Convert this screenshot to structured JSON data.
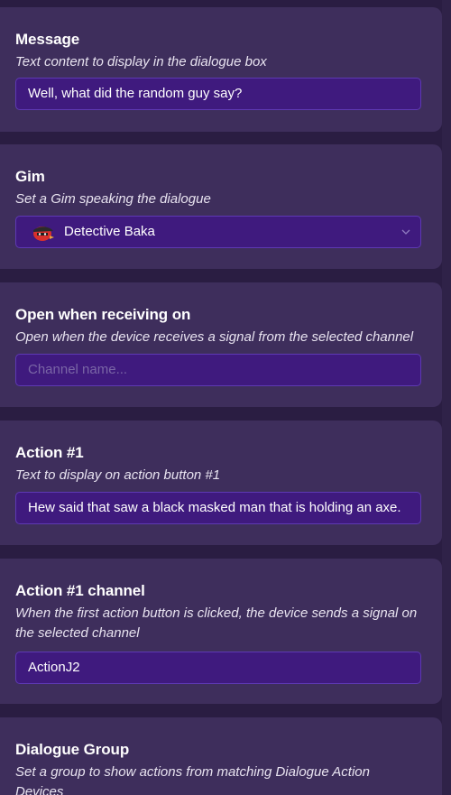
{
  "message": {
    "title": "Message",
    "description": "Text content to display in the dialogue box",
    "value": "Well, what did the random guy say?"
  },
  "gim": {
    "title": "Gim",
    "description": "Set a Gim speaking the dialogue",
    "value": "Detective Baka",
    "avatar_icon": "gim-avatar-icon"
  },
  "open_on": {
    "title": "Open when receiving on",
    "description": "Open when the device receives a signal from the selected channel",
    "placeholder": "Channel name..."
  },
  "action1": {
    "title": "Action #1",
    "description": "Text to display on action button #1",
    "value": "Hew said that saw a black masked man that is holding an axe."
  },
  "action1_channel": {
    "title": "Action #1 channel",
    "description": "When the first action button is clicked, the device sends a signal on the selected channel",
    "value": "ActionJ2"
  },
  "dialogue_group": {
    "title": "Dialogue Group",
    "description": "Set a group to show actions from matching Dialogue Action Devices"
  },
  "colors": {
    "background": "#2a1d42",
    "card": "#3e2e5c",
    "field": "#3f1a7e",
    "field_border": "#5e39b3"
  }
}
